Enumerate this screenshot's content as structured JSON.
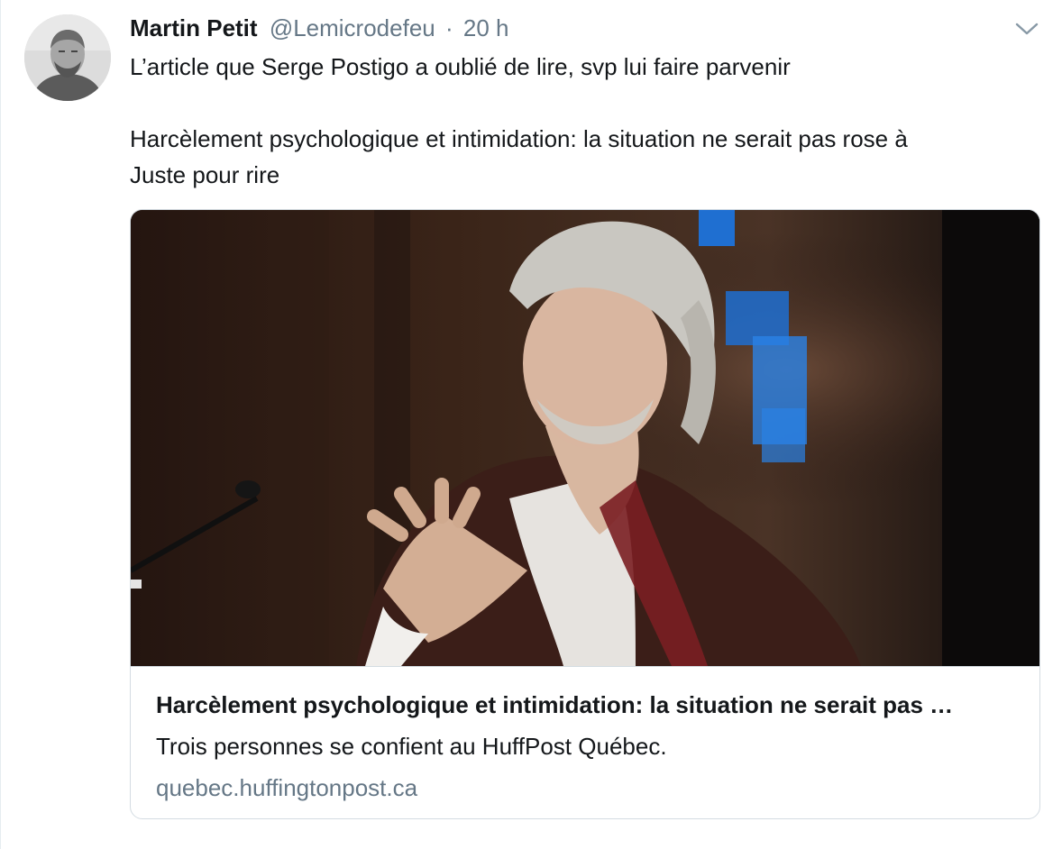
{
  "tweet": {
    "author_name": "Martin Petit",
    "author_handle": "@Lemicrodefeu",
    "separator": "·",
    "time": "20 h",
    "text_line1": "L’article que Serge Postigo a oublié de lire, svp lui faire parvenir",
    "text_line2a": "Harcèlement psychologique et intimidation: la situation ne serait pas rose à",
    "text_line2b": "Juste pour rire",
    "menu_icon": "chevron-down-icon"
  },
  "card": {
    "title": "Harcèlement psychologique et intimidation: la situation ne serait pas …",
    "description": "Trois personnes se confient au HuffPost Québec.",
    "domain": "quebec.huffingtonpost.ca"
  },
  "colors": {
    "text_primary": "#14171a",
    "text_secondary": "#657786",
    "border": "#d4dce2"
  }
}
